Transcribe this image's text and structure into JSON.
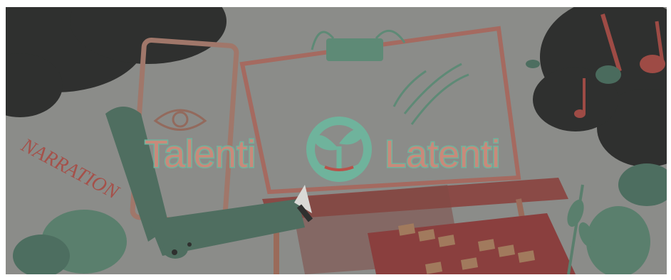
{
  "banner": {
    "logo": {
      "word_left": "Talenti",
      "word_right": "Latenti"
    },
    "side_word": "NARRATION",
    "colors": {
      "background": "#8a8b88",
      "dark_cloud": "#2f302f",
      "teal": "#5f8a76",
      "teal_light": "#6fae97",
      "coral": "#b4574e",
      "logo_fill": "#c98a7b",
      "logo_outline": "#6fb39c"
    }
  }
}
